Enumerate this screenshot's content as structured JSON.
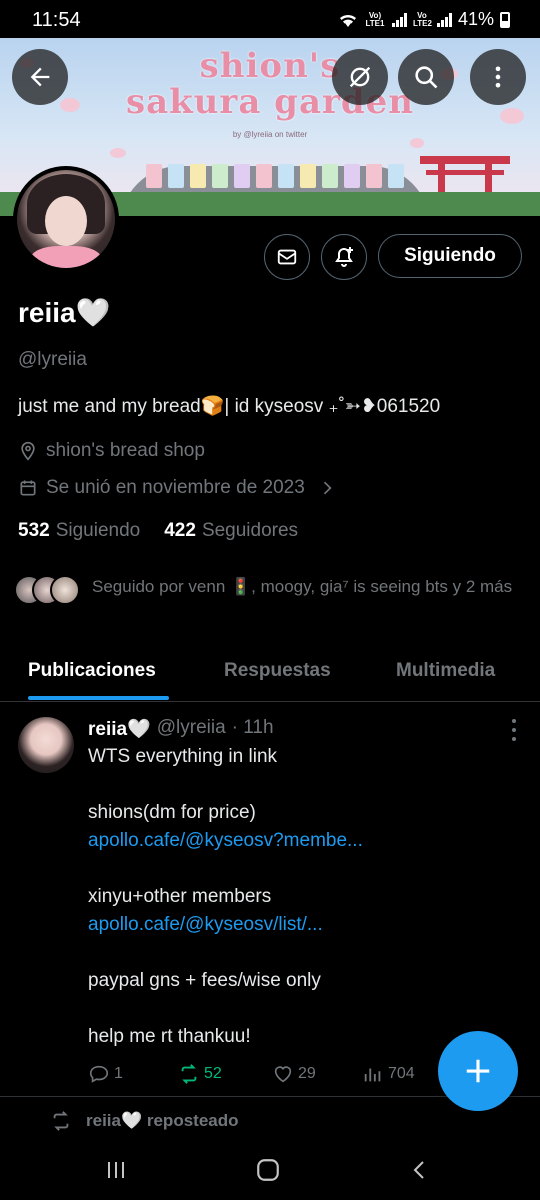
{
  "status_bar": {
    "time": "11:54",
    "network1": "Vo) LTE1",
    "network2": "Vo LTE2",
    "battery": "41%"
  },
  "banner": {
    "title_line1": "shion's",
    "title_line2": "sakura garden",
    "byline": "by @lyreiia on twitter"
  },
  "profile": {
    "display_name": "reiia🤍",
    "handle": "@lyreiia",
    "bio": "just me and my bread🍞| id kyseosv ₊˚➳❥061520",
    "location": "shion's bread shop",
    "joined": "Se unió en noviembre de 2023",
    "following_count": "532",
    "following_label": "Siguiendo",
    "followers_count": "422",
    "followers_label": "Seguidores",
    "followed_by": "Seguido por venn 🚦, moogy, gia⁷ is seeing bts y 2 más",
    "follow_button": "Siguiendo"
  },
  "tabs": [
    {
      "label": "Publicaciones",
      "active": true
    },
    {
      "label": "Respuestas",
      "active": false
    },
    {
      "label": "Multimedia",
      "active": false
    }
  ],
  "post": {
    "name": "reiia🤍",
    "handle": "@lyreiia",
    "time": "· 11h",
    "lines": [
      "WTS everything in link",
      "",
      "shions(dm for price)",
      "apollo.cafe/@kyseosv?membe...",
      "",
      "xinyu+other members",
      "apollo.cafe/@kyseosv/list/...",
      "",
      "paypal gns + fees/wise only",
      "",
      "help me rt thankuu!"
    ],
    "replies": "1",
    "reposts": "52",
    "likes": "29",
    "views": "704"
  },
  "next_item": {
    "repost_label": "reiia🤍 reposteado"
  },
  "colors": {
    "accent": "#1d9bf0",
    "repost_green": "#00ba7c",
    "muted": "#71767b",
    "border": "#2f3336"
  },
  "icons": [
    "back-arrow-icon",
    "hide-icon",
    "search-icon",
    "more-vertical-icon",
    "mail-icon",
    "bell-plus-icon",
    "location-pin-icon",
    "calendar-icon",
    "chevron-right-icon",
    "reply-icon",
    "repost-icon",
    "like-icon",
    "views-icon",
    "plus-icon"
  ]
}
